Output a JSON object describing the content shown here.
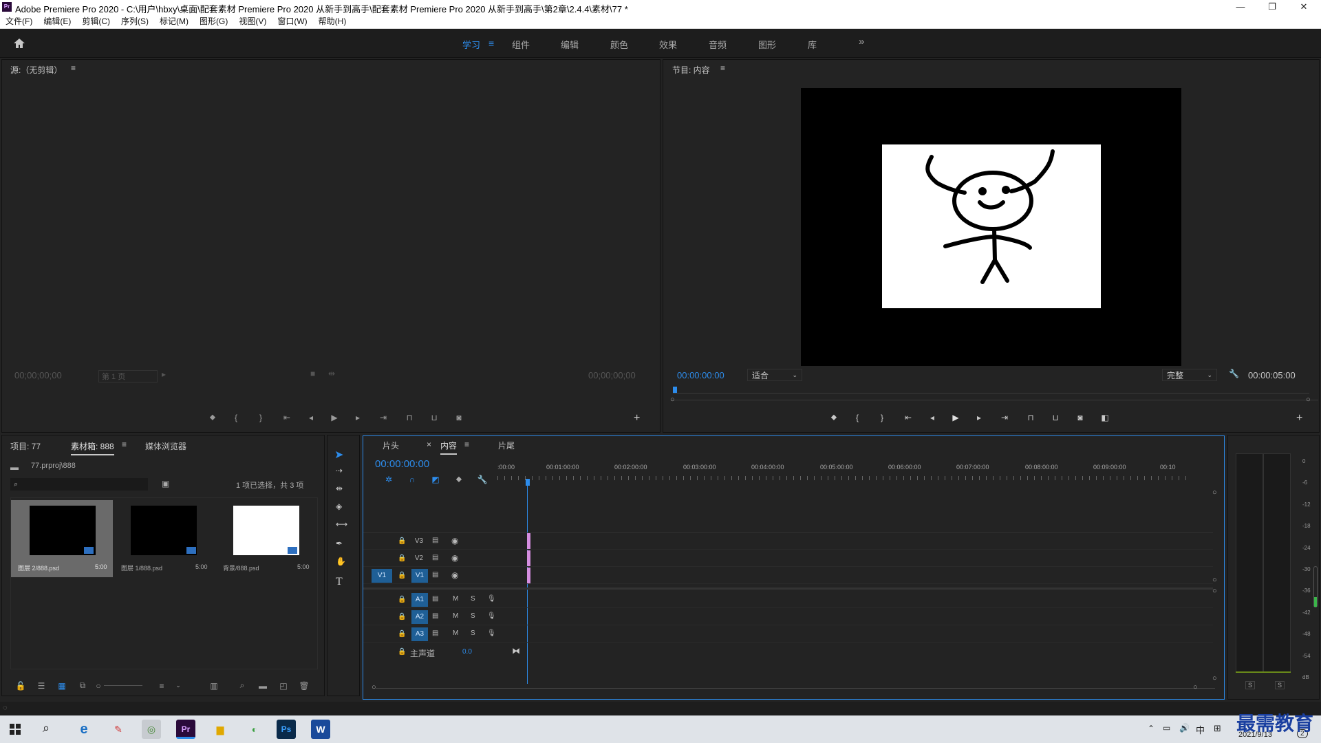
{
  "window": {
    "title": "Adobe Premiere Pro 2020 - C:\\用户\\hbxy\\桌面\\配套素材 Premiere Pro 2020 从新手到高手\\配套素材 Premiere Pro 2020 从新手到高手\\第2章\\2.4.4\\素材\\77 *",
    "app_badge": "Pr",
    "minimize": "—",
    "restore": "❐",
    "close": "✕"
  },
  "menu": [
    "文件(F)",
    "编辑(E)",
    "剪辑(C)",
    "序列(S)",
    "标记(M)",
    "图形(G)",
    "视图(V)",
    "窗口(W)",
    "帮助(H)"
  ],
  "workspaces": [
    {
      "label": "学习",
      "active": true
    },
    {
      "label": "组件"
    },
    {
      "label": "编辑"
    },
    {
      "label": "颜色"
    },
    {
      "label": "效果"
    },
    {
      "label": "音频"
    },
    {
      "label": "图形"
    },
    {
      "label": "库"
    }
  ],
  "workspace_more": "»",
  "source": {
    "title": "源:（无剪辑）",
    "timecode_left": "00;00;00;00",
    "page": "第 1 页",
    "timecode_right": "00;00;00;00"
  },
  "program": {
    "title": "节目: 内容",
    "timecode": "00:00:00:00",
    "fit": "适合",
    "quality": "完整",
    "duration": "00:00:05:00"
  },
  "project": {
    "tabs": [
      "项目: 77",
      "素材箱: 888",
      "媒体浏览器"
    ],
    "path": "77.prproj\\888",
    "selection": "1 项已选择，共 3 项",
    "items": [
      {
        "name": "图层 2/888.psd",
        "dur": "5:00",
        "color": "#000000",
        "selected": true
      },
      {
        "name": "图层 1/888.psd",
        "dur": "5:00",
        "color": "#000000"
      },
      {
        "name": "背景/888.psd",
        "dur": "5:00",
        "color": "#ffffff"
      }
    ]
  },
  "timeline": {
    "tabs": [
      "片头",
      "内容",
      "片尾"
    ],
    "close": "×",
    "timecode": "00:00:00:00",
    "ruler": [
      ":00:00",
      "00:01:00:00",
      "00:02:00:00",
      "00:03:00:00",
      "00:04:00:00",
      "00:05:00:00",
      "00:06:00:00",
      "00:07:00:00",
      "00:08:00:00",
      "00:09:00:00",
      "00:10"
    ],
    "video_tracks": [
      "V3",
      "V2",
      "V1"
    ],
    "audio_tracks": [
      "A1",
      "A2",
      "A3"
    ],
    "source_patch": "V1",
    "master_label": "主声道",
    "master_value": "0.0"
  },
  "meter": {
    "scale": [
      "0",
      "-6",
      "-12",
      "-18",
      "-24",
      "-30",
      "-36",
      "-42",
      "-48",
      "-54",
      "dB"
    ],
    "solo": [
      "S",
      "S"
    ]
  },
  "taskbar": {
    "time": "2021/9/13",
    "ime": "中",
    "notification": "2"
  },
  "watermark": "最需教育",
  "colors": {
    "accent": "#2d8ceb",
    "bg": "#232323",
    "panel_border": "#111111",
    "clip": "#d58ee0",
    "track_on": "#1f5f96"
  }
}
